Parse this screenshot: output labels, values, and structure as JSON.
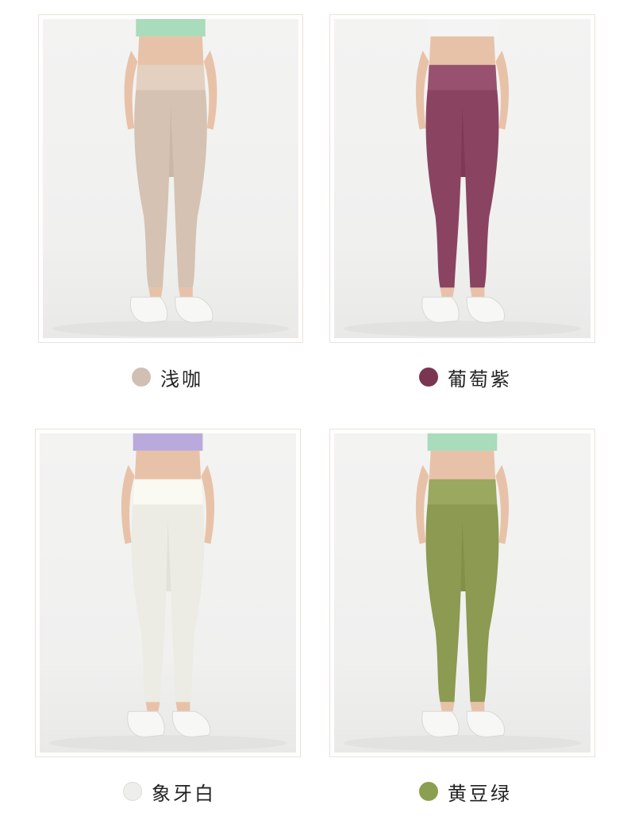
{
  "products": [
    {
      "name": "浅咖",
      "swatch_color": "#d2bfb3",
      "legging_color": "#d5c2b3",
      "top_color": "#a8dcbb",
      "image_icon": "model-legging-photo"
    },
    {
      "name": "葡萄紫",
      "swatch_color": "#7a3550",
      "legging_color": "#8a4462",
      "top_color": "#f4f4f4",
      "image_icon": "model-legging-photo"
    },
    {
      "name": "象牙白",
      "swatch_color": "#eeeeec",
      "legging_color": "#ecebe4",
      "top_color": "#b9a9dd",
      "image_icon": "model-legging-photo"
    },
    {
      "name": "黄豆绿",
      "swatch_color": "#8aa050",
      "legging_color": "#8c9a52",
      "top_color": "#a8dcbb",
      "image_icon": "model-legging-photo"
    }
  ]
}
